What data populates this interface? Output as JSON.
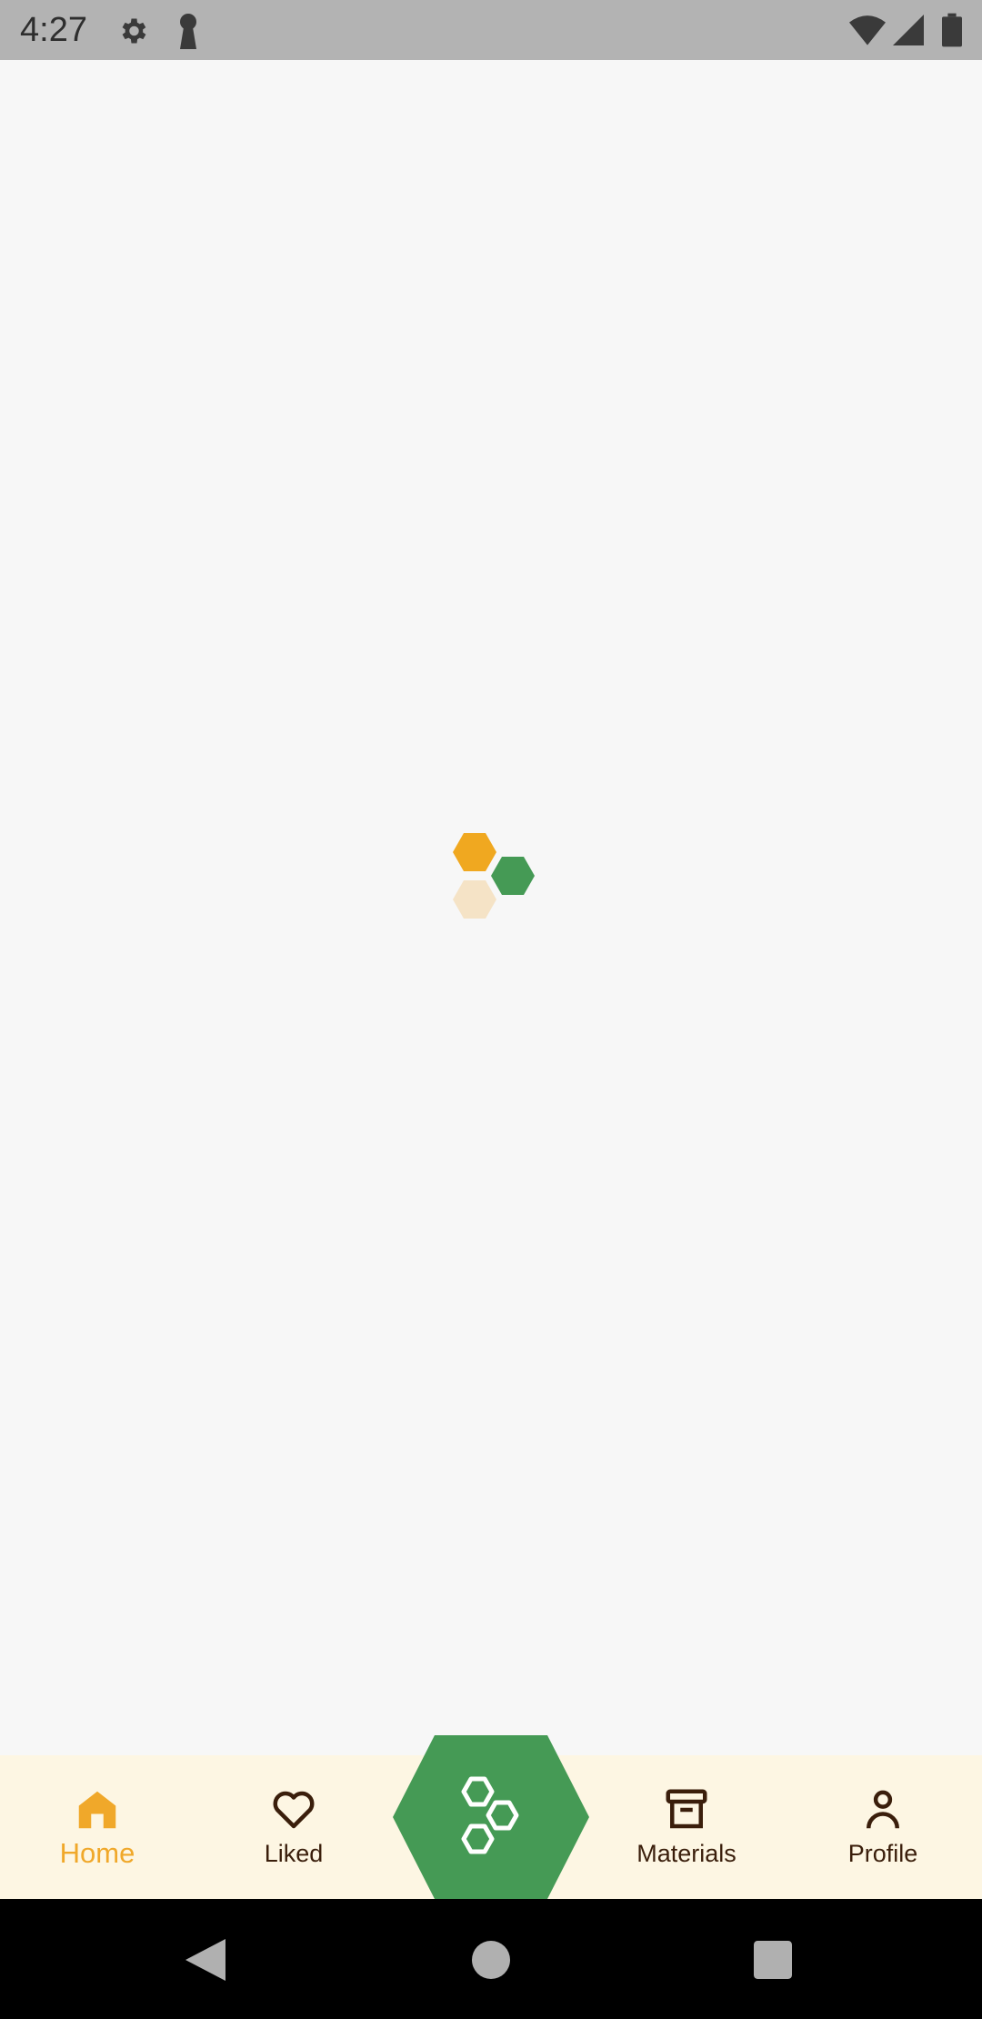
{
  "status_bar": {
    "time": "4:27",
    "left_icons": [
      "settings-icon",
      "keyhole-icon"
    ],
    "right_icons": [
      "wifi-icon",
      "signal-icon",
      "battery-icon"
    ]
  },
  "loader": {
    "colors": [
      "#f0a820",
      "#459a55",
      "#f5e3c6"
    ]
  },
  "bottom_nav": {
    "items": [
      {
        "label": "Home",
        "icon": "home-icon",
        "active": true
      },
      {
        "label": "Liked",
        "icon": "heart-icon",
        "active": false
      },
      {
        "label": "",
        "icon": "hexagons-icon",
        "active": false
      },
      {
        "label": "Materials",
        "icon": "archive-box-icon",
        "active": false
      },
      {
        "label": "Profile",
        "icon": "person-icon",
        "active": false
      }
    ]
  },
  "system_nav": {
    "buttons": [
      "back-icon",
      "home-circle-icon",
      "recents-icon"
    ]
  },
  "colors": {
    "accent": "#f0a82a",
    "primary_green": "#459a55",
    "nav_background": "#fdf6e3",
    "text_dark": "#3a1e0b"
  }
}
